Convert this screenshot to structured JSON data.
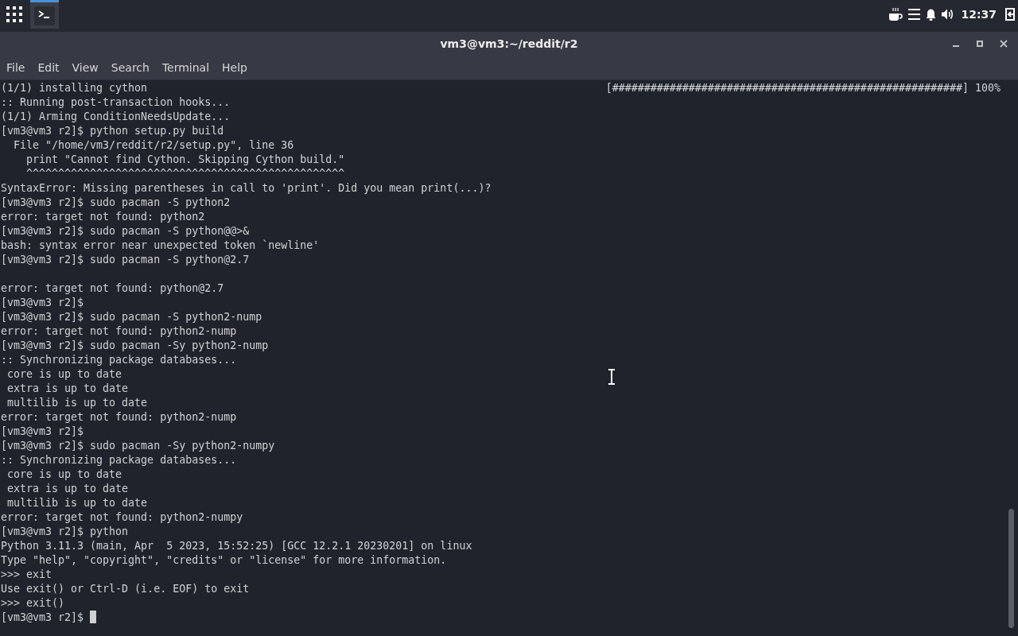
{
  "top_panel": {
    "taskbar": [
      {
        "selected": true
      }
    ],
    "clock": "12:37"
  },
  "window": {
    "title": "vm3@vm3:~/reddit/r2"
  },
  "menu_bar": [
    "File",
    "Edit",
    "View",
    "Search",
    "Terminal",
    "Help"
  ],
  "terminal": {
    "lines": [
      {
        "kind": "progress",
        "text": "(1/1) installing cython",
        "bar": "[#######################################################]",
        "percent": "100%"
      },
      {
        "kind": "text",
        "text": ":: Running post-transaction hooks..."
      },
      {
        "kind": "text",
        "text": "(1/1) Arming ConditionNeedsUpdate..."
      },
      {
        "kind": "text",
        "text": "[vm3@vm3 r2]$ python setup.py build"
      },
      {
        "kind": "text",
        "text": "  File \"/home/vm3/reddit/r2/setup.py\", line 36"
      },
      {
        "kind": "text",
        "text": "    print \"Cannot find Cython. Skipping Cython build.\""
      },
      {
        "kind": "text",
        "text": "    ^^^^^^^^^^^^^^^^^^^^^^^^^^^^^^^^^^^^^^^^^^^^^^^^^^"
      },
      {
        "kind": "text",
        "text": "SyntaxError: Missing parentheses in call to 'print'. Did you mean print(...)?"
      },
      {
        "kind": "text",
        "text": "[vm3@vm3 r2]$ sudo pacman -S python2"
      },
      {
        "kind": "text",
        "text": "error: target not found: python2"
      },
      {
        "kind": "text",
        "text": "[vm3@vm3 r2]$ sudo pacman -S python@@>&"
      },
      {
        "kind": "text",
        "text": "bash: syntax error near unexpected token `newline'"
      },
      {
        "kind": "text",
        "text": "[vm3@vm3 r2]$ sudo pacman -S python@2.7"
      },
      {
        "kind": "blank"
      },
      {
        "kind": "text",
        "text": "error: target not found: python@2.7"
      },
      {
        "kind": "text",
        "text": "[vm3@vm3 r2]$"
      },
      {
        "kind": "text",
        "text": "[vm3@vm3 r2]$ sudo pacman -S python2-nump"
      },
      {
        "kind": "text",
        "text": "error: target not found: python2-nump"
      },
      {
        "kind": "text",
        "text": "[vm3@vm3 r2]$ sudo pacman -Sy python2-nump"
      },
      {
        "kind": "text",
        "text": ":: Synchronizing package databases..."
      },
      {
        "kind": "text",
        "text": " core is up to date"
      },
      {
        "kind": "text",
        "text": " extra is up to date"
      },
      {
        "kind": "text",
        "text": " multilib is up to date"
      },
      {
        "kind": "text",
        "text": "error: target not found: python2-nump"
      },
      {
        "kind": "text",
        "text": "[vm3@vm3 r2]$"
      },
      {
        "kind": "text",
        "text": "[vm3@vm3 r2]$ sudo pacman -Sy python2-numpy"
      },
      {
        "kind": "text",
        "text": ":: Synchronizing package databases..."
      },
      {
        "kind": "text",
        "text": " core is up to date"
      },
      {
        "kind": "text",
        "text": " extra is up to date"
      },
      {
        "kind": "text",
        "text": " multilib is up to date"
      },
      {
        "kind": "text",
        "text": "error: target not found: python2-numpy"
      },
      {
        "kind": "text",
        "text": "[vm3@vm3 r2]$ python"
      },
      {
        "kind": "text",
        "text": "Python 3.11.3 (main, Apr  5 2023, 15:52:25) [GCC 12.2.1 20230201] on linux"
      },
      {
        "kind": "text",
        "text": "Type \"help\", \"copyright\", \"credits\" or \"license\" for more information."
      },
      {
        "kind": "text",
        "text": ">>> exit"
      },
      {
        "kind": "text",
        "text": "Use exit() or Ctrl-D (i.e. EOF) to exit"
      },
      {
        "kind": "text",
        "text": ">>> exit()"
      },
      {
        "kind": "prompt",
        "text": "[vm3@vm3 r2]$",
        "cursor": true
      }
    ]
  }
}
